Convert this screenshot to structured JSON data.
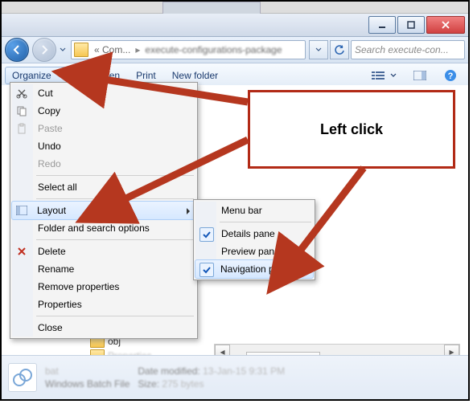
{
  "window": {
    "minimize_label": "Minimize",
    "maximize_label": "Maximize",
    "close_label": "Close"
  },
  "nav": {
    "crumb1": "« Com...",
    "crumb2": "execute-configurations-package",
    "search_placeholder": "Search execute-con..."
  },
  "toolbar": {
    "organize": "Organize",
    "open": "Open",
    "print": "Print",
    "newfolder": "New folder"
  },
  "organize_menu": {
    "cut": "Cut",
    "copy": "Copy",
    "paste": "Paste",
    "undo": "Undo",
    "redo": "Redo",
    "select_all": "Select all",
    "layout": "Layout",
    "folder_options": "Folder and search options",
    "delete": "Delete",
    "rename": "Rename",
    "remove_properties": "Remove properties",
    "properties": "Properties",
    "close": "Close"
  },
  "layout_submenu": {
    "menu_bar": "Menu bar",
    "details_pane": "Details pane",
    "preview_pane": "Preview pane",
    "navigation_pane": "Navigation pane",
    "details_checked": true,
    "navigation_checked": true
  },
  "files": {
    "item1": "obj",
    "item2": "Properties"
  },
  "callout": {
    "text": "Left click"
  },
  "details_pane": {
    "name": "bat",
    "type": "Windows Batch File",
    "modified_label": "Date modified:",
    "modified_value": "13-Jan-15 9:31 PM",
    "size_label": "Size:",
    "size_value": "275 bytes"
  }
}
